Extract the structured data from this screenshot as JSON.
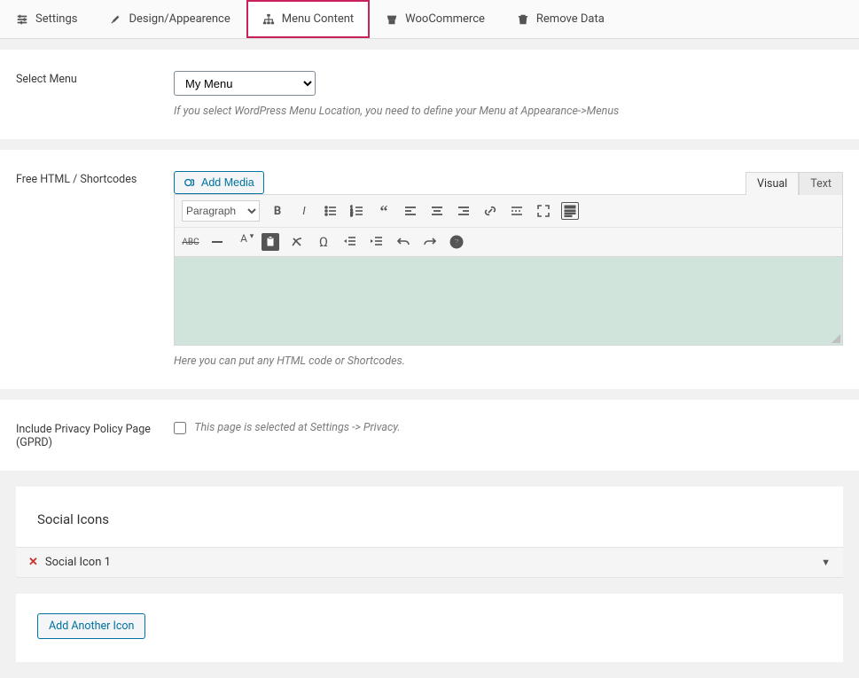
{
  "tabs": {
    "settings": "Settings",
    "design": "Design/Appearence",
    "menu": "Menu Content",
    "woo": "WooCommerce",
    "remove": "Remove Data"
  },
  "select_menu": {
    "label": "Select Menu",
    "value": "My Menu",
    "help": "If you select WordPress Menu Location, you need to define your Menu at Appearance->Menus"
  },
  "html_section": {
    "label": "Free HTML / Shortcodes",
    "add_media": "Add Media",
    "editor_tabs": {
      "visual": "Visual",
      "text": "Text"
    },
    "format": "Paragraph",
    "help": "Here you can put any HTML code or Shortcodes."
  },
  "privacy": {
    "label": "Include Privacy Policy Page (GPRD)",
    "help": "This page is selected at Settings -> Privacy."
  },
  "social": {
    "header": "Social Icons",
    "item1": "Social Icon 1",
    "add_another": "Add Another Icon"
  }
}
